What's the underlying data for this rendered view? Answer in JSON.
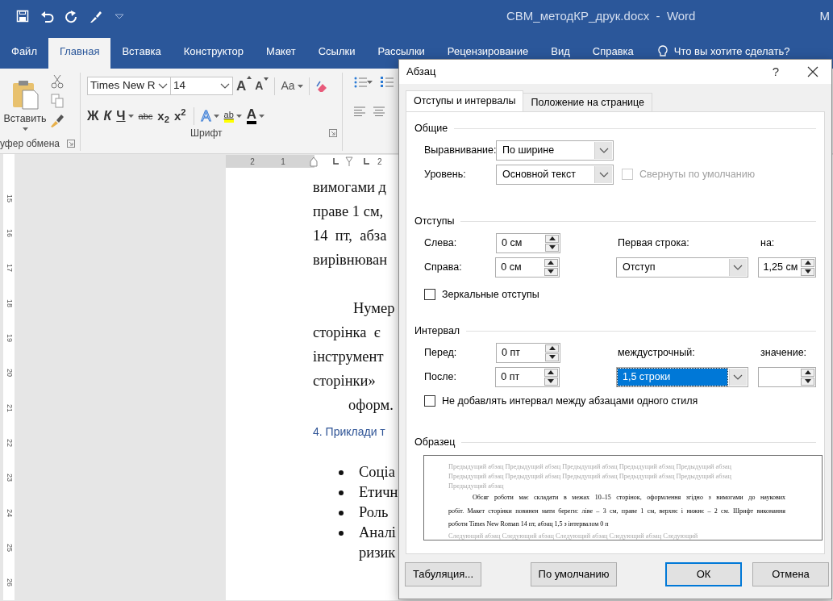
{
  "window": {
    "title": "СВМ_методКР_друк.docx  -  Word",
    "account": "М"
  },
  "quick_access": [
    {
      "kind": "save"
    },
    {
      "kind": "undo"
    },
    {
      "kind": "redo"
    },
    {
      "kind": "brush"
    },
    {
      "kind": "customize"
    }
  ],
  "ribbon_tabs": [
    {
      "label": "Файл",
      "selected": false
    },
    {
      "label": "Главная",
      "selected": true
    },
    {
      "label": "Вставка",
      "selected": false
    },
    {
      "label": "Конструктор",
      "selected": false
    },
    {
      "label": "Макет",
      "selected": false
    },
    {
      "label": "Ссылки",
      "selected": false
    },
    {
      "label": "Рассылки",
      "selected": false
    },
    {
      "label": "Рецензирование",
      "selected": false
    },
    {
      "label": "Вид",
      "selected": false
    },
    {
      "label": "Справка",
      "selected": false
    }
  ],
  "tell_me": "Что вы хотите сделать?",
  "clipboard": {
    "paste": "Вставить",
    "group_label": "уфер обмена"
  },
  "font": {
    "name": "Times New R",
    "size": "14",
    "grow": "A",
    "shrink": "A",
    "case_button": "Aa",
    "buttons": [
      {
        "kind": "bold",
        "label": "Ж"
      },
      {
        "kind": "italic",
        "label": "К"
      },
      {
        "kind": "underline",
        "label": "Ч"
      },
      {
        "kind": "strike",
        "label": "abc"
      },
      {
        "kind": "sub",
        "label": "x$_{2}$"
      },
      {
        "kind": "sup",
        "label": "x$^{2}$"
      }
    ],
    "effects": "A",
    "highlight": "ab",
    "color_button": "A",
    "group_label": "Шрифт"
  },
  "ruler": {
    "horizontal": [
      "2",
      "1",
      "2"
    ],
    "vertical": [
      "15",
      "16",
      "17",
      "18",
      "19",
      "20",
      "21",
      "22",
      "23",
      "24",
      "25",
      "26"
    ]
  },
  "document": [
    {
      "kind": "line",
      "text": "вимогами д"
    },
    {
      "kind": "line",
      "text": "праве 1 см,"
    },
    {
      "kind": "line",
      "text": "14  пт,  абза"
    },
    {
      "kind": "line",
      "text": "вирівнюван"
    },
    {
      "kind": "first",
      "text": "Нумер"
    },
    {
      "kind": "line",
      "text": "сторінка  є"
    },
    {
      "kind": "line",
      "text": "інструмент"
    },
    {
      "kind": "line",
      "text": "сторінки»"
    },
    {
      "kind": "indent",
      "text": "оформ."
    },
    {
      "kind": "heading",
      "text": "4. Приклади т"
    },
    {
      "kind": "bullet",
      "text": "Соціа"
    },
    {
      "kind": "bullet",
      "text": "Етичн"
    },
    {
      "kind": "bullet",
      "text": "Роль"
    },
    {
      "kind": "bullet",
      "text": "Аналі"
    },
    {
      "kind": "cont",
      "text": "ризик"
    }
  ],
  "dialog": {
    "title": "Абзац",
    "help": "?",
    "tabs": [
      {
        "label": "Отступы и интервалы",
        "selected": true
      },
      {
        "label": "Положение на странице",
        "selected": false
      }
    ],
    "general": {
      "heading": "Общие",
      "alignment_label": "Выравнивание:",
      "alignment": "По ширине",
      "level_label": "Уровень:",
      "level": "Основной текст",
      "collapsed": {
        "label": "Свернуты по умолчанию",
        "checked": false,
        "disabled": true
      }
    },
    "indents": {
      "heading": "Отступы",
      "left_label": "Слева:",
      "left": "0 см",
      "right_label": "Справа:",
      "right": "0 см",
      "first_line_label": "Первая строка:",
      "first_line": "Отступ",
      "by_label": "на:",
      "by": "1,25 см",
      "mirror": {
        "label": "Зеркальные отступы",
        "checked": false,
        "disabled": false
      }
    },
    "spacing": {
      "heading": "Интервал",
      "before_label": "Перед:",
      "before": "0 пт",
      "after_label": "После:",
      "after": "0 пт",
      "line_label": "междустрочный:",
      "line": "1,5 строки",
      "line_focused": true,
      "at_label": "значение:",
      "dont_add": {
        "label": "Не добавлять интервал между абзацами одного стиля",
        "checked": false,
        "disabled": false
      }
    },
    "preview": {
      "heading": "Образец",
      "previous": [
        "Предыдущий абзац Предыдущий абзац Предыдущий абзац Предыдущий абзац Предыдущий абзац",
        "Предыдущий абзац Предыдущий абзац Предыдущий абзац Предыдущий абзац Предыдущий абзац",
        "Предыдущий абзац"
      ],
      "sample": [
        "Обсяг роботи має складати в межах  10–15 сторінок, оформлення згідно з вимогами до наукових",
        "робіт. Макет сторінки повинен мати береги: ліве – 3 см, праве 1 см, верхнє і нижнє – 2 см. Шрифт виконання",
        "роботи Times New Roman 14 пт, абзац 1,5 з інтервалом 0 п"
      ],
      "next": [
        "Следующий абзац Следующий абзац Следующий абзац Следующий абзац Следующий"
      ]
    },
    "buttons": [
      {
        "label": "Табуляция...",
        "default": false
      },
      {
        "label": "По умолчанию",
        "default": false
      },
      {
        "label": "ОК",
        "default": true
      },
      {
        "label": "Отмена",
        "default": false
      }
    ]
  }
}
